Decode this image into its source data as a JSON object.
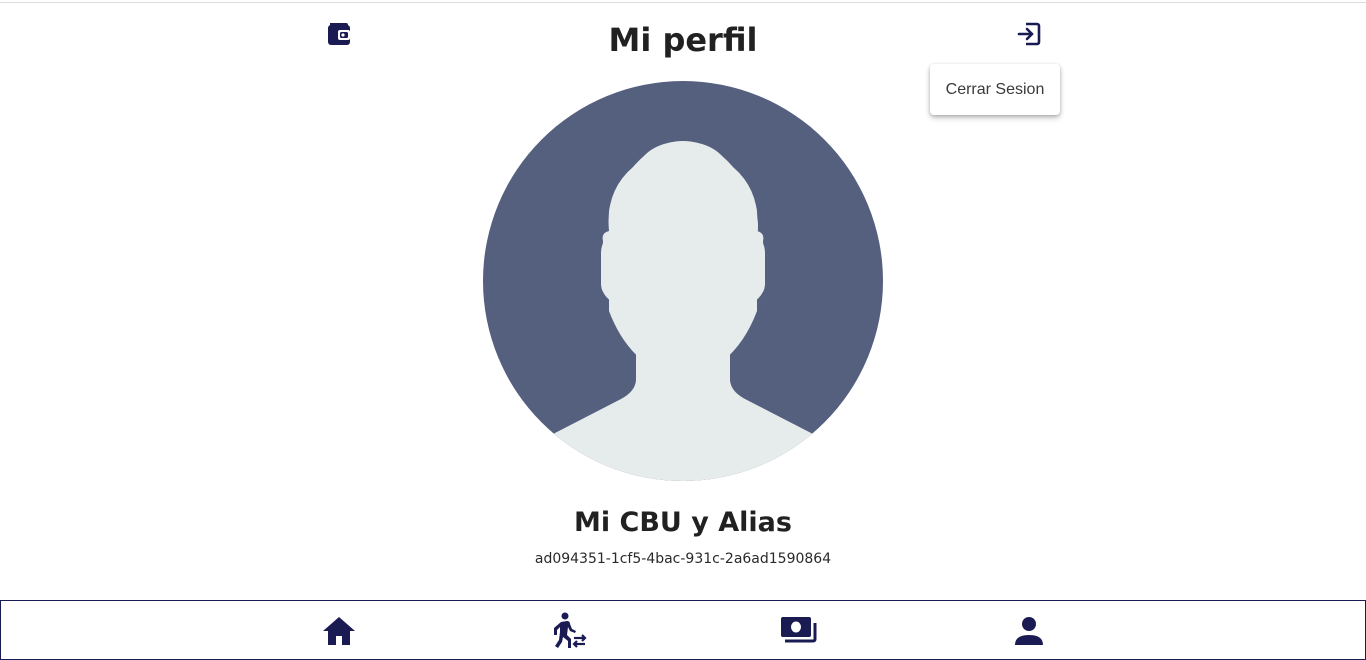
{
  "header": {
    "title": "Mi perfil",
    "wallet_icon": "wallet-icon",
    "logout_icon": "logout-icon"
  },
  "menu": {
    "items": [
      "Cerrar Sesion"
    ]
  },
  "profile": {
    "avatar_icon": "user-silhouette-icon",
    "section_title": "Mi CBU y Alias",
    "cbu_value": "ad094351-1cf5-4bac-931c-2a6ad1590864"
  },
  "bottom_nav": {
    "items": [
      {
        "name": "home",
        "icon": "home-icon"
      },
      {
        "name": "transfer",
        "icon": "transfer-icon"
      },
      {
        "name": "money",
        "icon": "money-icon"
      },
      {
        "name": "profile",
        "icon": "person-icon"
      }
    ]
  },
  "colors": {
    "brand_navy": "#1a1b52",
    "avatar_bg": "#55607f",
    "avatar_fg": "#e6ebec"
  }
}
